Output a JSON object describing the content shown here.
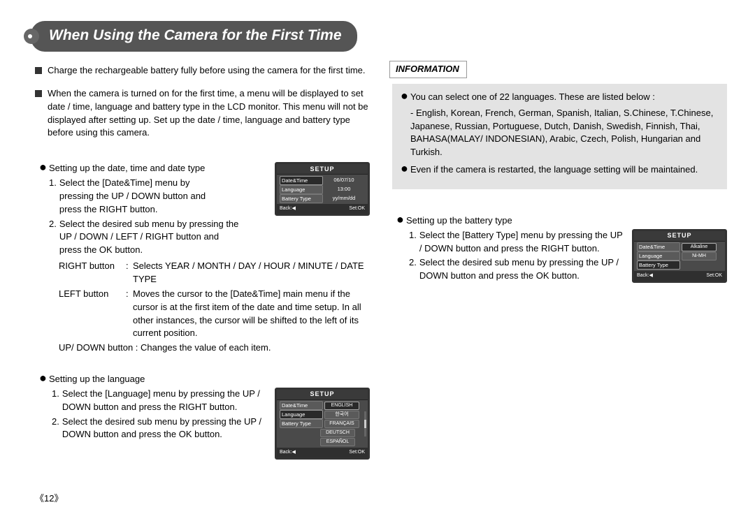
{
  "title": "When Using the Camera for the First Time",
  "page_number": "《12》",
  "left": {
    "para1": "Charge the rechargeable battery fully before using the camera for the first time.",
    "para2": "When the camera is turned on for the first time, a menu will be displayed to set date / time, language and battery type in the LCD monitor. This menu will not be displayed after setting up. Set up the date / time, language and battery type before using this camera.",
    "dt_heading": "Setting up the date, time and date type",
    "dt_step1": "Select the [Date&Time] menu by pressing the UP / DOWN button and press the RIGHT button.",
    "dt_step2": "Select the desired sub menu by pressing the UP / DOWN / LEFT / RIGHT button and press the OK button.",
    "right_btn_label": "RIGHT button",
    "right_btn_desc": "Selects YEAR / MONTH / DAY / HOUR / MINUTE / DATE TYPE",
    "left_btn_label": "LEFT button",
    "left_btn_desc": "Moves the cursor to the [Date&Time] main menu if the cursor is at the first item of the date and time setup. In all other instances, the cursor will be shifted to the left of its current position.",
    "ud_btn": "UP/ DOWN button : Changes the value of each item.",
    "lang_heading": "Setting up the language",
    "lang_step1": "Select the [Language] menu by pressing the UP / DOWN button and press the RIGHT button.",
    "lang_step2": "Select the desired sub menu by pressing the UP / DOWN button and press the OK button."
  },
  "right": {
    "info_title": "INFORMATION",
    "info_b1": "You can select one of 22 languages. These are listed below :",
    "info_list": "- English, Korean, French, German, Spanish, Italian, S.Chinese, T.Chinese, Japanese, Russian, Portuguese, Dutch, Danish, Swedish, Finnish, Thai, BAHASA(MALAY/ INDONESIAN), Arabic, Czech, Polish, Hungarian and Turkish.",
    "info_b2": "Even if the camera is restarted, the language setting will be maintained.",
    "bt_heading": "Setting up the battery type",
    "bt_step1": "Select the [Battery Type] menu by pressing the UP / DOWN button and press the RIGHT button.",
    "bt_step2": "Select the desired sub menu by pressing the UP / DOWN button and press the OK button."
  },
  "lcd_common": {
    "title": "SETUP",
    "k_date": "Date&Time",
    "k_lang": "Language",
    "k_batt": "Battery Type",
    "back": "Back:◀",
    "ok": "Set:OK"
  },
  "lcd_date": {
    "v_date": "06/07/10",
    "v_time": "13:00",
    "v_fmt": "yy/mm/dd"
  },
  "lcd_lang": {
    "opts": [
      "ENGLISH",
      "한국어",
      "FRANÇAIS",
      "DEUTSCH",
      "ESPAÑOL"
    ]
  },
  "lcd_batt": {
    "opts": [
      "Alkaline",
      "Ni-MH"
    ]
  }
}
